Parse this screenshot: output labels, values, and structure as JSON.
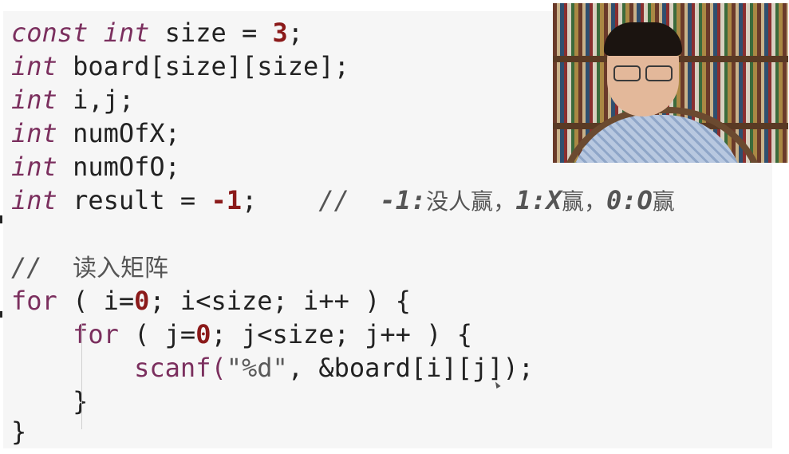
{
  "code": {
    "line1": {
      "kw": "const int",
      "rest": " size = ",
      "num": "3",
      "end": ";"
    },
    "line2": {
      "kw": "int",
      "rest": " board[size][size];"
    },
    "line3": {
      "kw": "int",
      "rest": " i,j;"
    },
    "line4": {
      "kw": "int",
      "rest": " numOfX;"
    },
    "line5": {
      "kw": "int",
      "rest": " numOfO;"
    },
    "line6": {
      "kw": "int",
      "rest": " result = ",
      "num": "-1",
      "end": ";",
      "comment_prefix": "    //  ",
      "c_a": "-1:",
      "c_b": "没人赢，",
      "c_c": "1:X",
      "c_d": "赢，",
      "c_e": "0:O",
      "c_f": "赢"
    },
    "line8": {
      "comment_prefix": "//  ",
      "text": "读入矩阵"
    },
    "line9": {
      "kw": "for",
      "a": " ( i=",
      "num": "0",
      "b": "; i<size; i++ ) {"
    },
    "line10": {
      "indent": "    ",
      "kw": "for",
      "a": " ( j=",
      "num": "0",
      "b": "; j<size; j++ ) {"
    },
    "line11": {
      "indent": "        ",
      "fn": "scanf(",
      "str": "\"%d\"",
      "rest": ", &board[i][j]);"
    },
    "line12": {
      "text": "    }"
    },
    "line13": {
      "text": "}"
    }
  },
  "colors": {
    "keyword": "#7b2f5e",
    "number": "#8b1a1a",
    "text": "#222222",
    "background": "#f6f6f6"
  },
  "webcam": {
    "icon": "presenter-video"
  }
}
